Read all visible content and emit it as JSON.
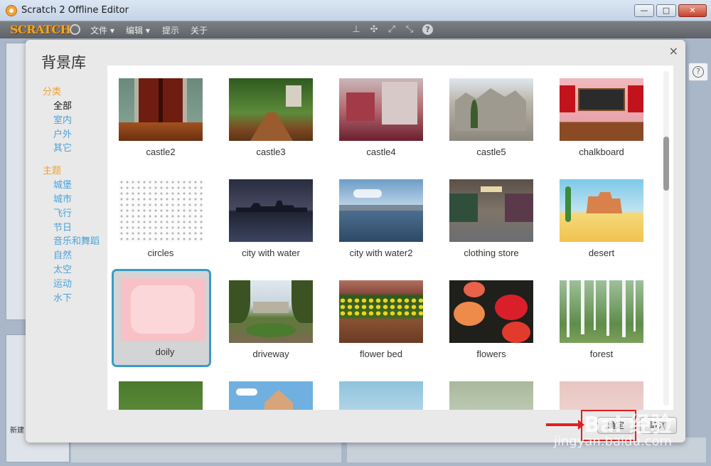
{
  "window": {
    "title": "Scratch 2 Offline Editor",
    "minimize": "—",
    "maximize": "□",
    "close": "✕"
  },
  "menubar": {
    "logo": "SCRATCH",
    "menus": [
      "文件 ▾",
      "编辑 ▾",
      "提示",
      "关于"
    ],
    "tools": [
      "stamp-icon",
      "cut-icon",
      "grow-icon",
      "shrink-icon",
      "help-icon"
    ]
  },
  "background": {
    "new_label": "新建",
    "help": "?"
  },
  "dialog": {
    "title": "背景库",
    "close": "×",
    "category_heading": "分类",
    "categories": [
      "全部",
      "室内",
      "户外",
      "其它"
    ],
    "theme_heading": "主题",
    "themes": [
      "城堡",
      "城市",
      "飞行",
      "节日",
      "音乐和舞蹈",
      "自然",
      "太空",
      "运动",
      "水下"
    ],
    "ok_label": "确定",
    "cancel_label": "取消"
  },
  "backdrops": [
    {
      "name": "castle2"
    },
    {
      "name": "castle3"
    },
    {
      "name": "castle4"
    },
    {
      "name": "castle5"
    },
    {
      "name": "chalkboard"
    },
    {
      "name": "circles"
    },
    {
      "name": "city with water"
    },
    {
      "name": "city with water2"
    },
    {
      "name": "clothing store"
    },
    {
      "name": "desert"
    },
    {
      "name": "doily",
      "selected": true
    },
    {
      "name": "driveway"
    },
    {
      "name": "flower bed"
    },
    {
      "name": "flowers"
    },
    {
      "name": "forest"
    }
  ],
  "watermark": {
    "brand": "Bai 经验",
    "url": "jingyan.baidu.com"
  },
  "colors": {
    "accent": "#3a9cc4",
    "category_heading": "#f0a136",
    "category_link": "#4aa2d8",
    "annotation_red": "#e02020"
  }
}
